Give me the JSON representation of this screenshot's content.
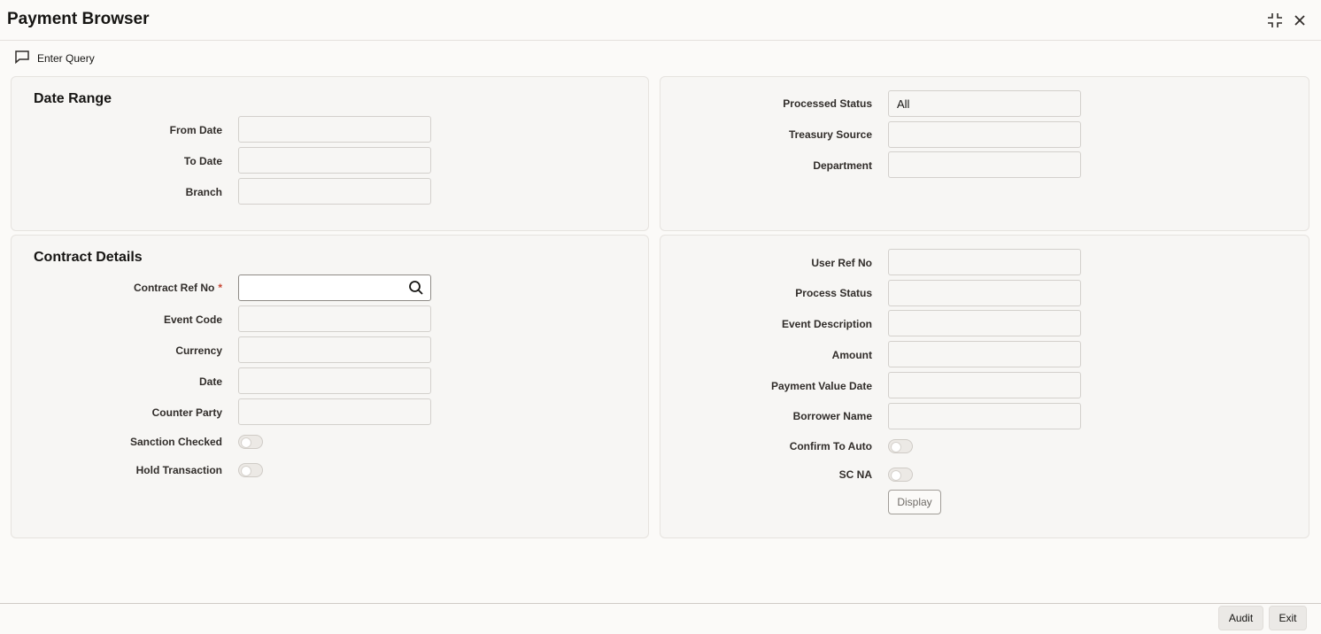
{
  "window": {
    "title": "Payment Browser",
    "maximize_icon": "maximize-icon",
    "close_icon": "close-icon"
  },
  "toolbar": {
    "enter_query_label": "Enter Query",
    "enter_query_icon": "comment-icon"
  },
  "date_range": {
    "title": "Date Range",
    "from_date_label": "From Date",
    "from_date_value": "",
    "to_date_label": "To Date",
    "to_date_value": "",
    "branch_label": "Branch",
    "branch_value": ""
  },
  "status_panel": {
    "processed_status_label": "Processed Status",
    "processed_status_value": "All",
    "treasury_source_label": "Treasury Source",
    "treasury_source_value": "",
    "department_label": "Department",
    "department_value": ""
  },
  "contract_details": {
    "title": "Contract Details",
    "contract_ref_no_label": "Contract Ref No",
    "contract_ref_no_required": "*",
    "contract_ref_no_value": "",
    "event_code_label": "Event Code",
    "event_code_value": "",
    "currency_label": "Currency",
    "currency_value": "",
    "date_label": "Date",
    "date_value": "",
    "counter_party_label": "Counter Party",
    "counter_party_value": "",
    "sanction_checked_label": "Sanction Checked",
    "hold_transaction_label": "Hold Transaction"
  },
  "details_panel": {
    "user_ref_no_label": "User Ref No",
    "user_ref_no_value": "",
    "process_status_label": "Process Status",
    "process_status_value": "",
    "event_description_label": "Event Description",
    "event_description_value": "",
    "amount_label": "Amount",
    "amount_value": "",
    "payment_value_date_label": "Payment Value Date",
    "payment_value_date_value": "",
    "borrower_name_label": "Borrower Name",
    "borrower_name_value": "",
    "confirm_to_auto_label": "Confirm To Auto",
    "sc_na_label": "SC NA",
    "display_label": "Display"
  },
  "footer": {
    "audit_label": "Audit",
    "exit_label": "Exit"
  },
  "colors": {
    "background": "#fbfaf8",
    "panel": "#f7f6f4",
    "required": "#c74634",
    "text": "#161513"
  }
}
